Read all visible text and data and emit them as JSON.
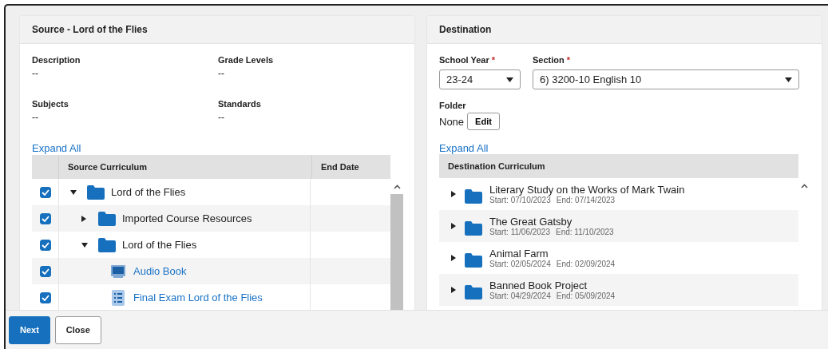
{
  "source": {
    "title": "Source - Lord of the Flies",
    "fields": [
      {
        "label": "Description",
        "value": "--"
      },
      {
        "label": "Grade Levels",
        "value": "--"
      },
      {
        "label": "Subjects",
        "value": "--"
      },
      {
        "label": "Standards",
        "value": "--"
      }
    ],
    "expand_all": "Expand All",
    "table": {
      "columns": [
        "Source Curriculum",
        "End Date"
      ],
      "rows": [
        {
          "kind": "folder",
          "name": "Lord of the Flies",
          "checked": true,
          "expanded": true,
          "children": [
            {
              "kind": "folder",
              "name": "Imported Course Resources",
              "checked": true,
              "expanded": false
            },
            {
              "kind": "folder",
              "name": "Lord of the Flies",
              "checked": true,
              "expanded": true,
              "children": [
                {
                  "kind": "media",
                  "name": "Audio Book",
                  "checked": true
                },
                {
                  "kind": "assessment",
                  "name": "Final Exam Lord of the Flies",
                  "checked": true
                }
              ]
            }
          ]
        }
      ]
    }
  },
  "destination": {
    "title": "Destination",
    "school_year": {
      "label": "School Year",
      "required_mark": "*",
      "value": "23-24"
    },
    "section": {
      "label": "Section",
      "required_mark": "*",
      "value": "6) 3200-10 English 10"
    },
    "folder": {
      "label": "Folder",
      "value": "None",
      "button": "Edit"
    },
    "expand_all": "Expand All",
    "table": {
      "columns": [
        "Destination Curriculum"
      ],
      "rows": [
        {
          "name": "Literary Study on the Works of Mark Twain",
          "start": "Start: 07/10/2023",
          "end": "End: 07/14/2023",
          "expanded": false
        },
        {
          "name": "The Great Gatsby",
          "start": "Start: 11/06/2023",
          "end": "End: 11/10/2023",
          "expanded": false
        },
        {
          "name": "Animal Farm",
          "start": "Start: 02/05/2024",
          "end": "End: 02/09/2024",
          "expanded": false
        },
        {
          "name": "Banned Book Project",
          "start": "Start: 04/29/2024",
          "end": "End: 05/09/2024",
          "expanded": false
        }
      ]
    }
  },
  "buttons": [
    {
      "label": "Next",
      "kind": "primary"
    },
    {
      "label": "Close",
      "kind": "secondary"
    }
  ]
}
